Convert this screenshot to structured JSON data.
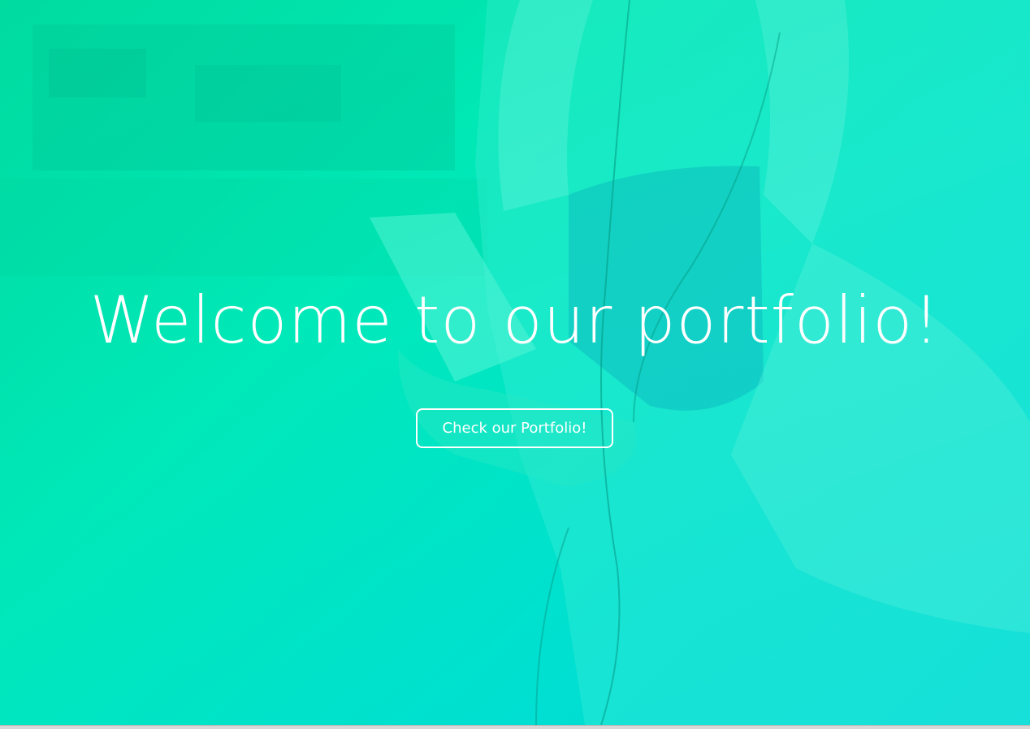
{
  "hero": {
    "title": "Welcome to our portfolio!",
    "cta_label": "Check our Portfolio!",
    "background_image": "woman-holding-smartphone-photo",
    "overlay_colors": [
      "#00d6a0",
      "#00e8b8",
      "#00dfd0",
      "#00d7d9"
    ],
    "text_color": "#ffffff"
  }
}
